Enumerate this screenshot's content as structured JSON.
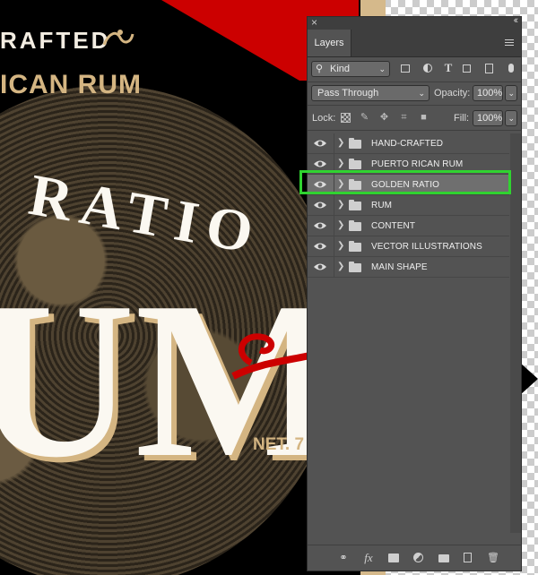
{
  "canvas_art": {
    "top_text": "RAFTED",
    "sub_text": "ICAN RUM",
    "arc_text": "RATIO",
    "big_text": "UM",
    "net_text": "NET. 7"
  },
  "panel": {
    "close_glyph": "×",
    "collapse_glyph": "‹‹",
    "tab_label": "Layers",
    "filter": {
      "search_glyph": "⚲",
      "kind_label": "Kind",
      "arrow": "⌄"
    },
    "blend_mode": "Pass Through",
    "opacity_label": "Opacity:",
    "opacity_value": "100%",
    "lock_label": "Lock:",
    "fill_label": "Fill:",
    "fill_value": "100%",
    "layers": [
      {
        "name": "HAND-CRAFTED",
        "type": "folder",
        "visible": true
      },
      {
        "name": "PUERTO RICAN RUM",
        "type": "folder",
        "visible": true
      },
      {
        "name": "GOLDEN RATIO",
        "type": "folder",
        "visible": true,
        "highlighted": true
      },
      {
        "name": "RUM",
        "type": "folder",
        "visible": true
      },
      {
        "name": "CONTENT",
        "type": "folder",
        "visible": true
      },
      {
        "name": "VECTOR ILLUSTRATIONS",
        "type": "folder",
        "visible": true
      },
      {
        "name": "MAIN SHAPE",
        "type": "folder",
        "visible": true
      }
    ],
    "footer_icons": [
      "link-icon",
      "fx-icon",
      "mask-icon",
      "adjustment-icon",
      "folder-icon",
      "new-layer-icon",
      "trash-icon"
    ],
    "footer_fx_text": "fx",
    "highlight_color": "#30d330"
  }
}
